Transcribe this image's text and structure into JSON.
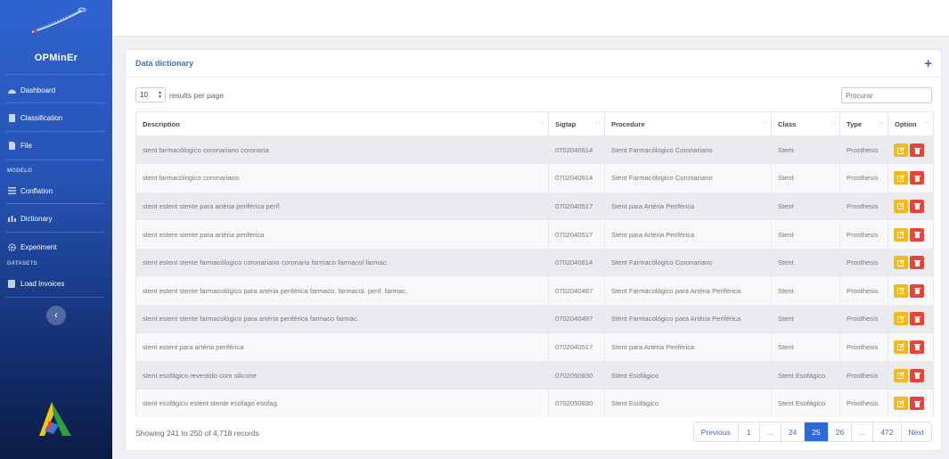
{
  "sidebar": {
    "brand": "OPMinEr",
    "items": [
      {
        "label": "Dashboard",
        "icon": "dashboard-icon"
      },
      {
        "label": "Classification",
        "icon": "document-icon"
      },
      {
        "label": "File",
        "icon": "file-icon"
      }
    ],
    "section_model": "MODELO",
    "model_items": [
      {
        "label": "Conflation",
        "icon": "list-icon"
      },
      {
        "label": "Dictionary",
        "icon": "bar-chart-icon"
      },
      {
        "label": "Experiment",
        "icon": "gear-icon"
      }
    ],
    "section_datasets": "DATASETS",
    "dataset_items": [
      {
        "label": "Load Invoices",
        "icon": "table-icon"
      }
    ],
    "collapse_icon": "chevron-left-icon",
    "collapse_glyph": "‹"
  },
  "card": {
    "title": "Data dictionary",
    "plus": "+",
    "length_value": "10",
    "length_suffix": "results per page",
    "search_placeholder": "Procurar"
  },
  "table": {
    "columns": [
      "Description",
      "Sigtap",
      "Procedure",
      "Class",
      "Type",
      "Option"
    ],
    "rows": [
      [
        "stent farmacólogico coronariano coronaria",
        "0702040614",
        "Stent Farmacólogico Coronariano",
        "Stent",
        "Prosthesis"
      ],
      [
        "stent farmacólogico coronariano",
        "0702040614",
        "Stent Farmacólogico Coronariano",
        "Stent",
        "Prosthesis"
      ],
      [
        "stent estent stente para artéria periférica perif.",
        "0702040517",
        "Stent para Artéria Periférica",
        "Stent",
        "Prosthesis"
      ],
      [
        "stent estent stente para artéria periférica",
        "0702040517",
        "Stent para Artéria Periférica",
        "Stent",
        "Prosthesis"
      ],
      [
        "stent estent stente farmacólogico coronariano coronaria farmaco farmacol farmac.",
        "0702040614",
        "Stent Farmacólogico Coronariano",
        "Stent",
        "Prosthesis"
      ],
      [
        "stent estent stente farmacológico para artéria periférica farmaco. farmacol. perif. farmac.",
        "0702040487",
        "Stent Farmacológico para Artéria Periférica",
        "Stent",
        "Prosthesis"
      ],
      [
        "stent estent stente farmacológico para artéria periférica farmaco farmac.",
        "0702040487",
        "Stent Farmacológico para Artéria Periférica",
        "Stent",
        "Prosthesis"
      ],
      [
        "stent estent para artéria periférica",
        "0702040517",
        "Stent para Artéria Periférica",
        "Stent",
        "Prosthesis"
      ],
      [
        "stent esofágico revestido com silicone",
        "0702050830",
        "Stent Esofágico",
        "Stent Esofágico",
        "Prosthesis"
      ],
      [
        "stent esofágico estent stente esofago esofag.",
        "0702050830",
        "Stent Esofágico",
        "Stent Esofágico",
        "Prosthesis"
      ]
    ]
  },
  "footer": {
    "info": "Showing 241 to 250 of 4,718 records",
    "pages": [
      "Previous",
      "1",
      "...",
      "24",
      "25",
      "26",
      "...",
      "472",
      "Next"
    ],
    "active_page": "25"
  },
  "colors": {
    "accent": "#2f6bd8",
    "edit": "#f6b91b",
    "delete": "#e8443a"
  }
}
